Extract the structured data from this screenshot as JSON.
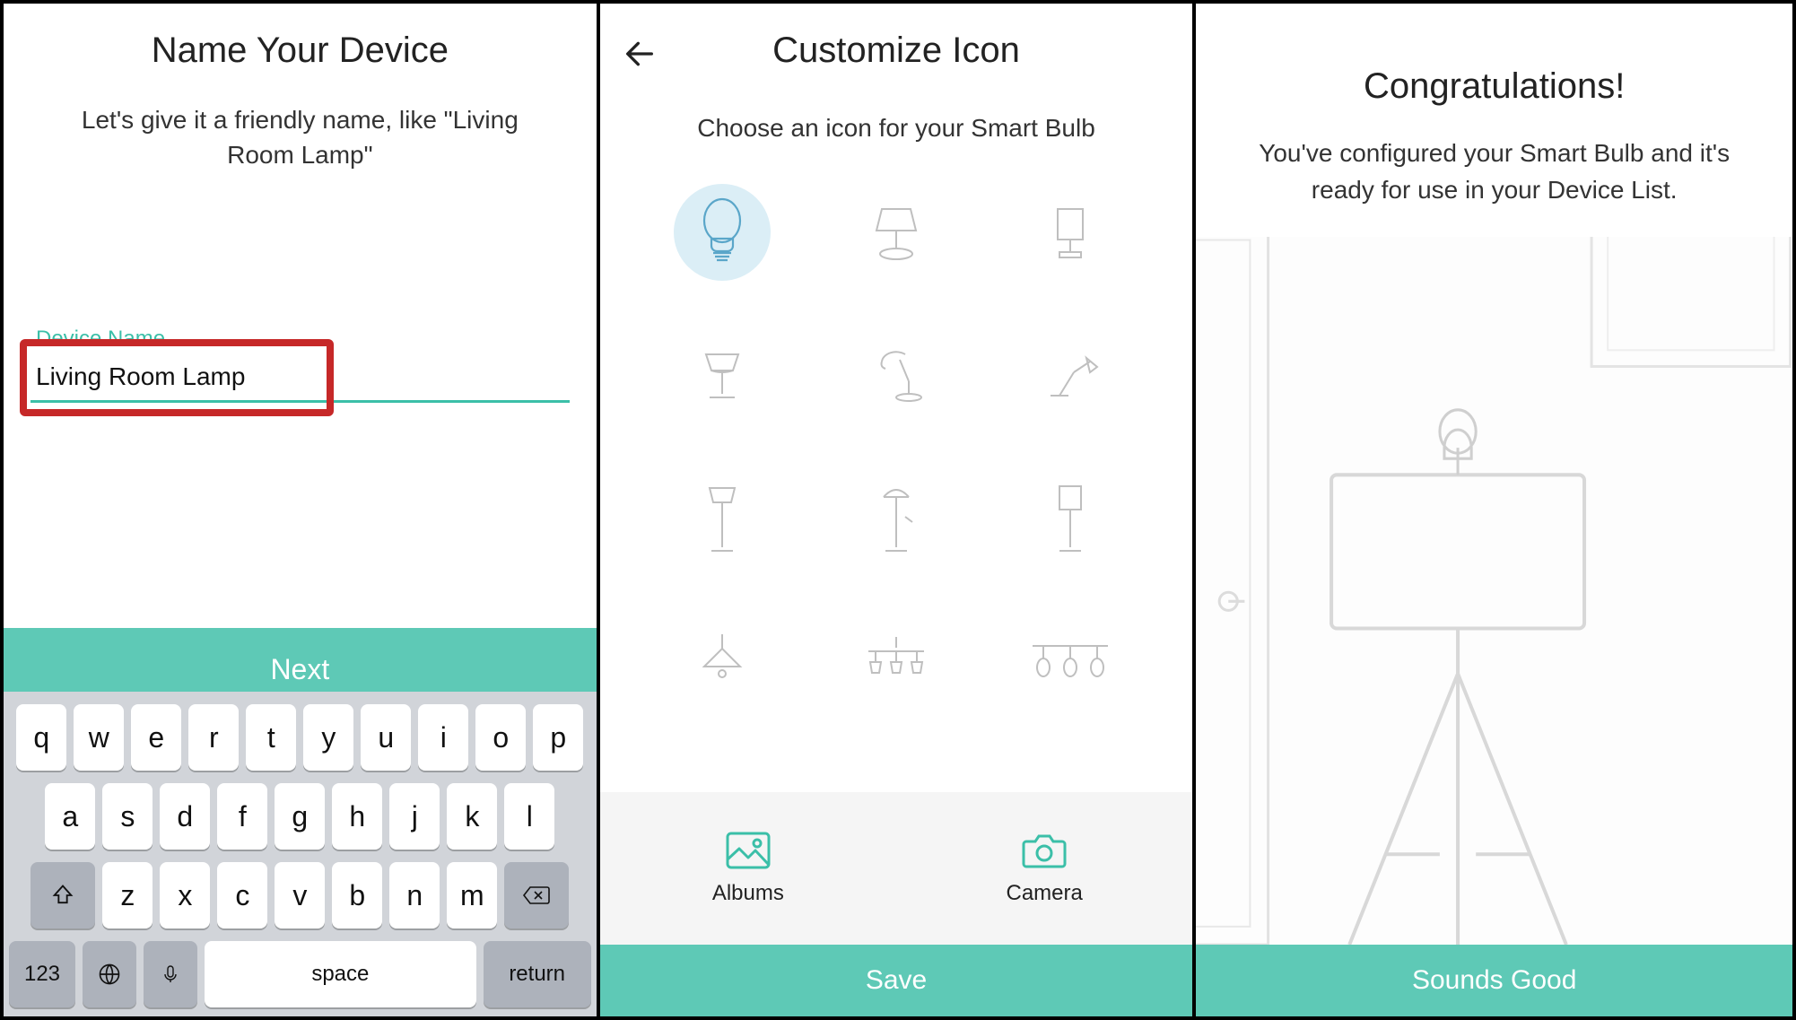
{
  "panel1": {
    "title": "Name Your Device",
    "subtitle": "Let's give it a friendly name, like \"Living Room Lamp\"",
    "field_label": "Device Name",
    "device_name": "Living Room Lamp",
    "next_label": "Next",
    "keyboard": {
      "row1": [
        "q",
        "w",
        "e",
        "r",
        "t",
        "y",
        "u",
        "i",
        "o",
        "p"
      ],
      "row2": [
        "a",
        "s",
        "d",
        "f",
        "g",
        "h",
        "j",
        "k",
        "l"
      ],
      "row3": [
        "z",
        "x",
        "c",
        "v",
        "b",
        "n",
        "m"
      ],
      "numbers_label": "123",
      "space_label": "space",
      "return_label": "return"
    }
  },
  "panel2": {
    "title": "Customize Icon",
    "subtitle": "Choose an icon for your Smart Bulb",
    "icons": [
      "bulb",
      "table-lamp-shade",
      "box-lamp",
      "table-lamp-classic",
      "desk-lamp",
      "arm-lamp",
      "floor-lamp",
      "torchiere",
      "floor-box-lamp",
      "pendant",
      "chandelier-triple",
      "track-lights"
    ],
    "selected_index": 0,
    "albums_label": "Albums",
    "camera_label": "Camera",
    "save_label": "Save"
  },
  "panel3": {
    "title": "Congratulations!",
    "subtitle": "You've configured your Smart Bulb and it's ready for use in your Device List.",
    "cta_label": "Sounds Good"
  }
}
